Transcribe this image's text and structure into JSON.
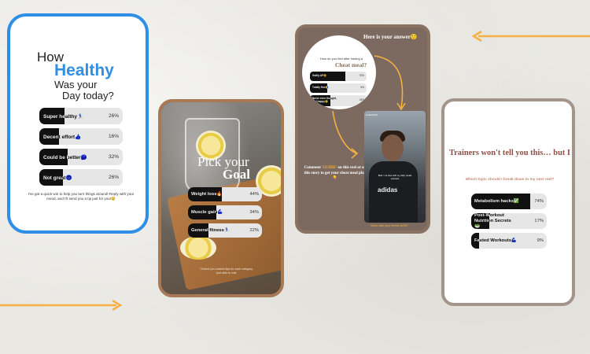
{
  "colors": {
    "blue_accent": "#2f8fe6",
    "card2_border": "#a77a55",
    "card3_border": "#8a7263",
    "card4_border": "#a3958a",
    "arrow_orange": "#f5b043",
    "title_brown": "#8c4f46"
  },
  "card1": {
    "title_line1": "How",
    "title_line2": "Healthy",
    "title_line3": "Was your",
    "title_line4": "Day today?",
    "options": [
      {
        "label": "Super healthy🏃",
        "percent": "26%",
        "fill": 0.3
      },
      {
        "label": "Decent effort👍",
        "percent": "16%",
        "fill": 0.24
      },
      {
        "label": "Could be better🤔",
        "percent": "32%",
        "fill": 0.34
      },
      {
        "label": "Not great😐",
        "percent": "26%",
        "fill": 0.28
      }
    ],
    "note": "I've got a quick win to help you turn things around! Reply with your mood, and I'll send you a tip just for you!😊"
  },
  "card2": {
    "heading_line1": "Pick your",
    "heading_line2": "Goal",
    "options": [
      {
        "label": "Weight loss🔥",
        "percent": "44%",
        "fill": 0.46
      },
      {
        "label": "Muscle gain💪",
        "percent": "34%",
        "fill": 0.38
      },
      {
        "label": "General fitness🏃",
        "percent": "22%",
        "fill": 0.28
      }
    ],
    "note": "I'll send you custom tips for each category, just click to vote"
  },
  "card3": {
    "answer": "Here is your answer🙂",
    "question_line1": "How do you feel after having a",
    "question_line2": "Cheat meal?",
    "options": [
      {
        "label": "Guilty AF😩",
        "percent": "75%",
        "fill": 0.62
      },
      {
        "label": "Totally fine😋",
        "percent": "6%",
        "fill": 0.3
      },
      {
        "label": "Never even thought, just happy😊",
        "percent": "18%",
        "fill": 0.36
      }
    ],
    "comment_prefix": "Comment",
    "comment_keyword": "'GUIDE'",
    "comment_rest": "on this reel or on this story to get your cheat meal plan👇",
    "reel_handle": "aniketthakur",
    "reel_caption": "Bulk / cut plan with my daily meals example",
    "reel_logo": "adidas",
    "share": "Share with your friends NOW!"
  },
  "card4": {
    "title": "Trainers won't tell you this… but I will!",
    "subtitle": "Which topic should I break down in my next reel?",
    "options": [
      {
        "label": "Metabolism hacks✅",
        "percent": "74%",
        "fill": 0.78
      },
      {
        "label": "Post-Workout Nutrition Secrets🥗",
        "percent": "17%",
        "fill": 0.24
      },
      {
        "label": "Fasted Workouts💪",
        "percent": "9%",
        "fill": 0.1
      }
    ]
  }
}
